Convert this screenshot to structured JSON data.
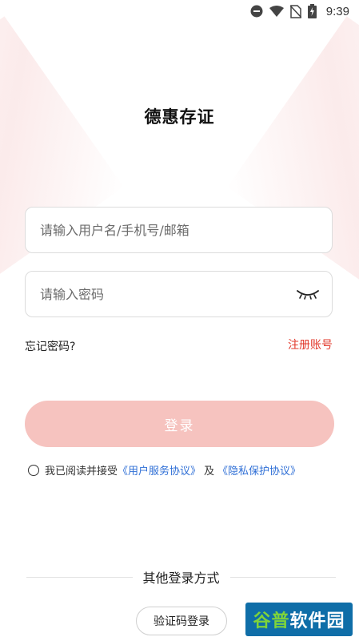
{
  "status_bar": {
    "time": "9:39",
    "icons": [
      "do-not-disturb-icon",
      "wifi-icon",
      "no-sim-icon",
      "battery-charging-icon"
    ]
  },
  "app": {
    "title": "德惠存证"
  },
  "form": {
    "username_placeholder": "请输入用户名/手机号/邮箱",
    "password_placeholder": "请输入密码",
    "forgot_password": "忘记密码?",
    "register": "注册账号",
    "login_button": "登录"
  },
  "agreement": {
    "prefix": "我已阅读并接受",
    "user_agreement": "《用户服务协议》",
    "conjunction": "及",
    "privacy_agreement": "《隐私保护协议》"
  },
  "other_login": {
    "heading": "其他登录方式",
    "code_login": "验证码登录"
  },
  "watermark": {
    "text_part1": "谷普",
    "text_part2": "软件园"
  },
  "colors": {
    "accent_red": "#e2382b",
    "login_button_bg": "#f6c3bf",
    "link_blue": "#2f6fd6"
  }
}
